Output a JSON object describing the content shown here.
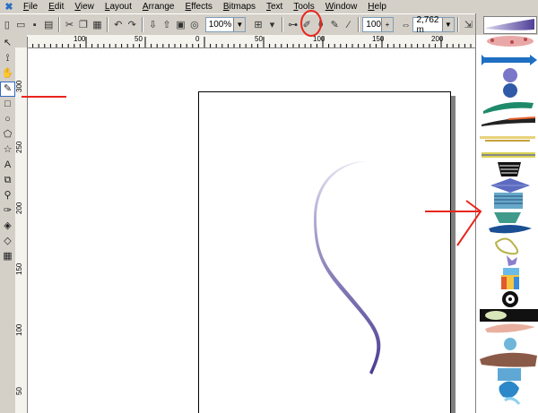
{
  "menu": {
    "items": [
      "File",
      "Edit",
      "View",
      "Layout",
      "Arrange",
      "Effects",
      "Bitmaps",
      "Text",
      "Tools",
      "Window",
      "Help"
    ]
  },
  "toolbar": {
    "zoom_value": "100%",
    "width_value": "100",
    "stroke_width_value": "2,762 m"
  },
  "rulers": {
    "horizontal_labels": [
      "100",
      "50",
      "0",
      "50",
      "100",
      "150",
      "200"
    ],
    "vertical_labels": [
      "300",
      "250",
      "200",
      "150",
      "100",
      "50"
    ]
  },
  "tools": [
    "pick-tool",
    "shape-tool",
    "knife-tool",
    "freehand-tool",
    "rectangle-tool",
    "ellipse-tool",
    "polygon-tool",
    "star-tool",
    "text-tool",
    "interactive-blend-tool",
    "eyedropper-tool",
    "outline-tool",
    "fill-tool",
    "interactive-fill-tool",
    "mesh-tool"
  ],
  "brushes": [
    "brush-1",
    "brush-2",
    "brush-3",
    "brush-4",
    "brush-5",
    "brush-6",
    "brush-7",
    "brush-8",
    "brush-9",
    "brush-10",
    "brush-11",
    "brush-12",
    "brush-13",
    "brush-14",
    "brush-15",
    "brush-16",
    "brush-17",
    "brush-18",
    "brush-19",
    "brush-20"
  ],
  "colors": {
    "stroke": "#5b4f9c",
    "annotation": "#e8261c",
    "selection": "#316ac5"
  }
}
